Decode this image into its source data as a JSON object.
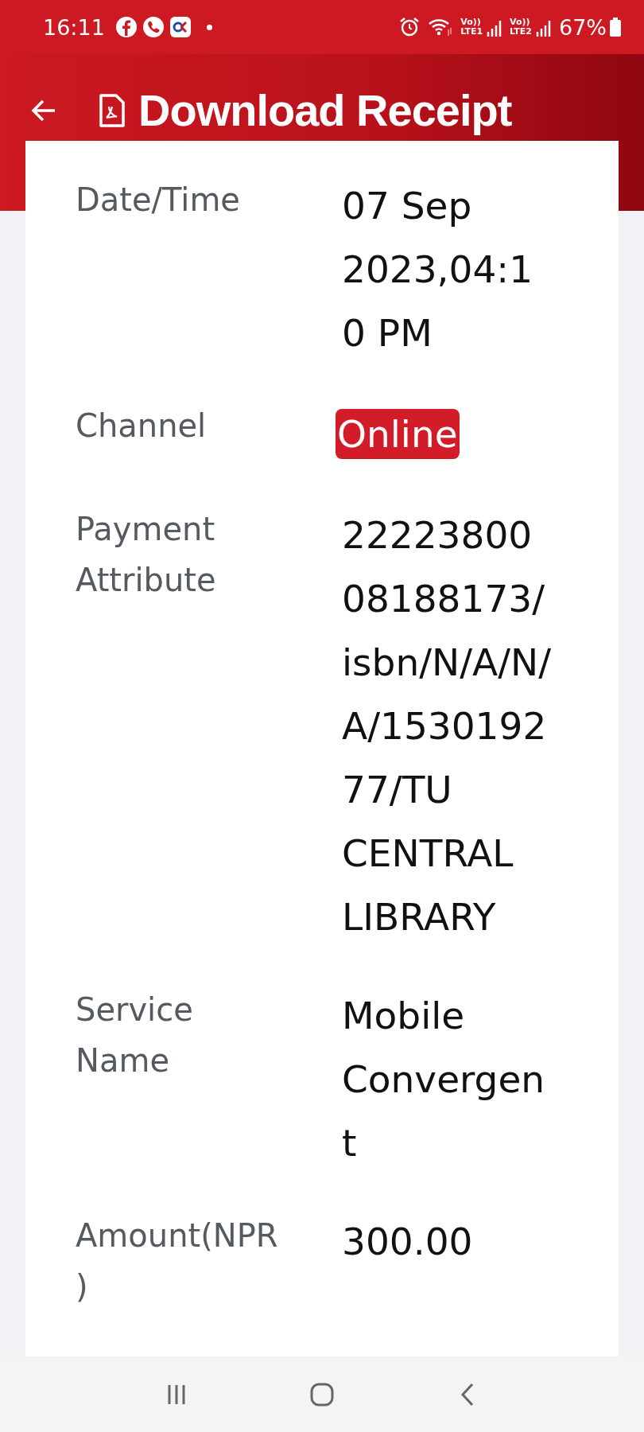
{
  "status_bar": {
    "time": "16:11",
    "notification_icons": [
      {
        "kind": "facebook"
      },
      {
        "kind": "phone"
      },
      {
        "kind": "app"
      }
    ],
    "sims": [
      {
        "top": "Vo))",
        "bottom": "LTE1"
      },
      {
        "top": "Vo))",
        "bottom": "LTE2"
      }
    ],
    "battery": "67%"
  },
  "header": {
    "title": "Download Receipt"
  },
  "rows": [
    {
      "kind": "text",
      "label": "Date/Time",
      "value": "07 Sep 2023,04:10 PM"
    },
    {
      "kind": "badge",
      "label": "Channel",
      "value": "Online"
    },
    {
      "kind": "text",
      "label": "Payment Attribute",
      "value": "2222380008188173/isbn/N/A/N/A/153019277/TU CENTRAL LIBRARY"
    },
    {
      "kind": "text",
      "label": "Service Name",
      "value": "Mobile Convergent"
    },
    {
      "kind": "text",
      "label": "Amount(NPR)",
      "value": "300.00"
    }
  ]
}
